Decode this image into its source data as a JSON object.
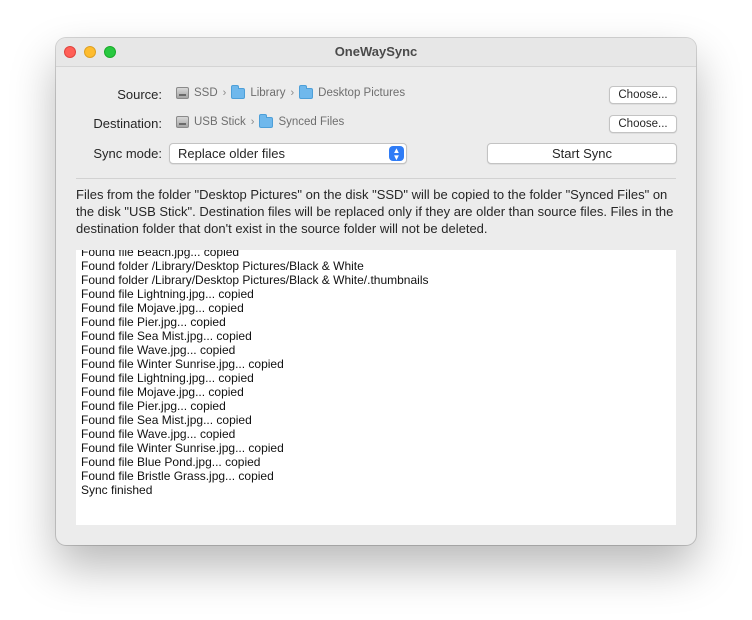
{
  "window": {
    "title": "OneWaySync"
  },
  "source": {
    "label": "Source:",
    "path": [
      "SSD",
      "Library",
      "Desktop Pictures"
    ],
    "choose_label": "Choose..."
  },
  "destination": {
    "label": "Destination:",
    "path": [
      "USB Stick",
      "Synced Files"
    ],
    "choose_label": "Choose..."
  },
  "sync_mode": {
    "label": "Sync mode:",
    "value": "Replace older files"
  },
  "start_sync_label": "Start Sync",
  "description": "Files from the folder \"Desktop Pictures\" on the disk \"SSD\" will be copied to the folder \"Synced Files\" on the disk \"USB Stick\". Destination files will be replaced only if they are older than source files. Files in the destination folder that don't exist in the source folder will not be deleted.",
  "log": [
    "Found file Beach.jpg... copied",
    "Found folder /Library/Desktop Pictures/Black & White",
    "Found folder /Library/Desktop Pictures/Black & White/.thumbnails",
    "Found file Lightning.jpg... copied",
    "Found file Mojave.jpg... copied",
    "Found file Pier.jpg... copied",
    "Found file Sea Mist.jpg... copied",
    "Found file Wave.jpg... copied",
    "Found file Winter Sunrise.jpg... copied",
    "Found file Lightning.jpg... copied",
    "Found file Mojave.jpg... copied",
    "Found file Pier.jpg... copied",
    "Found file Sea Mist.jpg... copied",
    "Found file Wave.jpg... copied",
    "Found file Winter Sunrise.jpg... copied",
    "Found file Blue Pond.jpg... copied",
    "Found file Bristle Grass.jpg... copied",
    "Sync finished"
  ]
}
